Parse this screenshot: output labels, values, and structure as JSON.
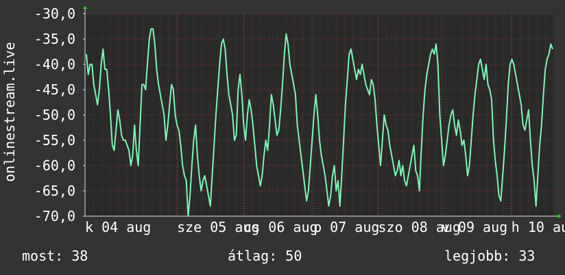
{
  "colors": {
    "background": "#333333",
    "plot": "#2a2a2a",
    "grid": "#8a3a3a",
    "line": "#7cf5b4",
    "text": "#ffffff",
    "arrow": "#22cc22"
  },
  "side_label": "onlinestream.live",
  "footer": {
    "now_label": "most:",
    "now_value": "38",
    "avg_label": "átlag:",
    "avg_value": "50",
    "best_label": "legjobb:",
    "best_value": "33"
  },
  "chart_data": {
    "type": "line",
    "ylabel": "onlinestream.live",
    "ylim": [
      -70,
      -30
    ],
    "grid": true,
    "yticks": [
      "-30,0",
      "-35,0",
      "-40,0",
      "-45,0",
      "-50,0",
      "-55,0",
      "-60,0",
      "-65,0",
      "-70,0"
    ],
    "xticks": [
      "k 04 aug",
      "sze 05 aug",
      "cs 06 aug",
      "p 07 aug",
      "szo 08 aug",
      "v 09 aug",
      "h 10 aug"
    ],
    "xtick_fraction": [
      0.0,
      0.196,
      0.338,
      0.487,
      0.625,
      0.76,
      0.909
    ],
    "series": [
      {
        "values": [
          -38,
          -42,
          -40,
          -40,
          -44,
          -46,
          -48,
          -45,
          -40,
          -37,
          -41,
          -41,
          -45,
          -50,
          -56,
          -57,
          -53,
          -49,
          -51,
          -54,
          -55,
          -55,
          -56,
          -57,
          -60,
          -58,
          -52,
          -57,
          -60,
          -52,
          -44,
          -44,
          -45,
          -40,
          -35,
          -33,
          -33,
          -36,
          -41,
          -44,
          -46,
          -48,
          -50,
          -55,
          -52,
          -48,
          -44,
          -45,
          -50,
          -52,
          -53,
          -56,
          -60,
          -62,
          -63,
          -70,
          -66,
          -60,
          -55,
          -52,
          -58,
          -62,
          -65,
          -63,
          -62,
          -64,
          -66,
          -68,
          -62,
          -56,
          -50,
          -45,
          -40,
          -36,
          -35,
          -37,
          -42,
          -46,
          -48,
          -50,
          -55,
          -54,
          -45,
          -42,
          -46,
          -52,
          -55,
          -50,
          -47,
          -49,
          -52,
          -56,
          -60,
          -62,
          -64,
          -62,
          -58,
          -55,
          -57,
          -52,
          -46,
          -48,
          -51,
          -54,
          -53,
          -49,
          -44,
          -38,
          -34,
          -36,
          -40,
          -42,
          -44,
          -46,
          -52,
          -55,
          -58,
          -61,
          -64,
          -67,
          -65,
          -60,
          -55,
          -50,
          -46,
          -50,
          -55,
          -58,
          -60,
          -62,
          -65,
          -68,
          -66,
          -62,
          -60,
          -65,
          -63,
          -68,
          -62,
          -55,
          -48,
          -43,
          -38,
          -37,
          -39,
          -41,
          -43,
          -41,
          -42,
          -40,
          -42,
          -44,
          -45,
          -46,
          -43,
          -44,
          -47,
          -52,
          -56,
          -60,
          -55,
          -50,
          -52,
          -53,
          -56,
          -58,
          -60,
          -62,
          -61,
          -59,
          -62,
          -60,
          -63,
          -64,
          -62,
          -60,
          -58,
          -56,
          -61,
          -62,
          -65,
          -57,
          -50,
          -45,
          -42,
          -40,
          -38,
          -37,
          -38,
          -36,
          -40,
          -50,
          -55,
          -60,
          -58,
          -55,
          -52,
          -50,
          -49,
          -52,
          -54,
          -51,
          -53,
          -56,
          -55,
          -58,
          -62,
          -60,
          -55,
          -50,
          -46,
          -43,
          -40,
          -39,
          -41,
          -43,
          -40,
          -44,
          -45,
          -47,
          -55,
          -59,
          -62,
          -66,
          -67,
          -62,
          -57,
          -51,
          -44,
          -40,
          -39,
          -40,
          -42,
          -44,
          -46,
          -48,
          -52,
          -53,
          -51,
          -49,
          -55,
          -60,
          -63,
          -68,
          -62,
          -56,
          -52,
          -46,
          -41,
          -39,
          -38,
          -36,
          -37
        ]
      }
    ]
  }
}
